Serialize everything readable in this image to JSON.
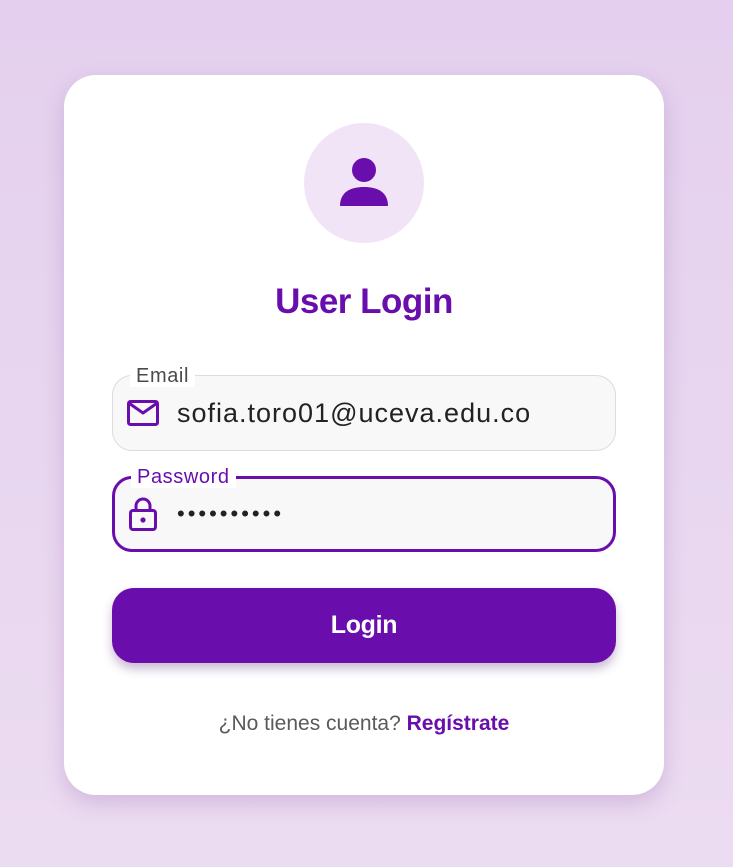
{
  "login": {
    "title": "User Login",
    "email": {
      "label": "Email",
      "value": "sofia.toro01@uceva.edu.co"
    },
    "password": {
      "label": "Password",
      "value": "••••••••••"
    },
    "submit_label": "Login",
    "signup_prompt": "¿No tienes cuenta?",
    "signup_link": "Regístrate"
  },
  "icons": {
    "avatar": "person-icon",
    "email": "mail-icon",
    "password": "lock-icon"
  },
  "colors": {
    "accent": "#6a0dad",
    "avatar_bg": "#f2e4f7",
    "page_bg": "#e4d0ee"
  }
}
